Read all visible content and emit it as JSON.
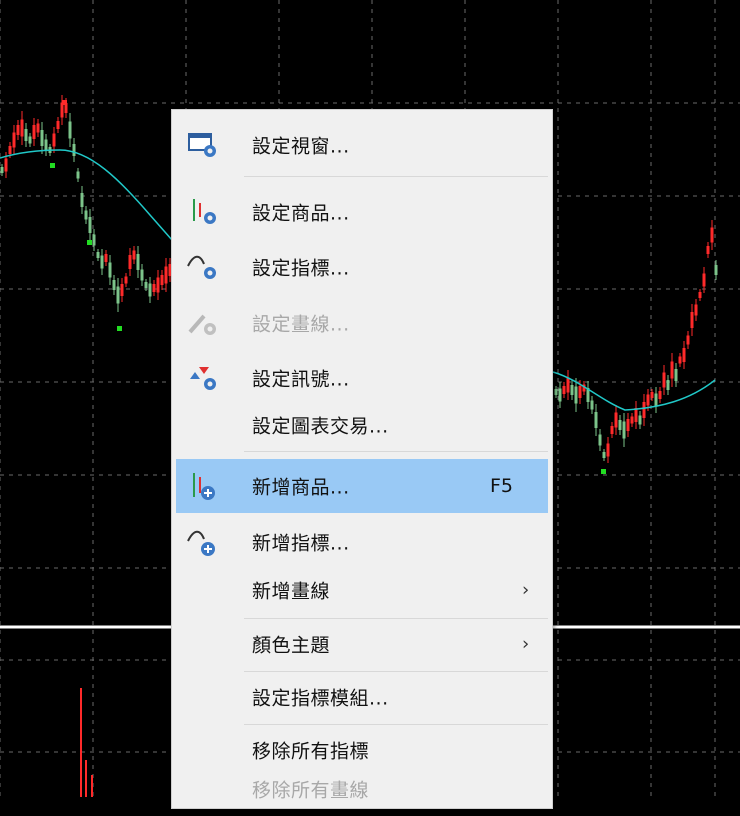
{
  "menu": {
    "items": [
      {
        "label": "設定視窗...",
        "icon": "window-settings-icon",
        "shortcut": "",
        "submenu": false,
        "disabled": false,
        "highlighted": false
      },
      {
        "label": "設定商品...",
        "icon": "symbol-settings-icon",
        "shortcut": "",
        "submenu": false,
        "disabled": false,
        "highlighted": false
      },
      {
        "label": "設定指標...",
        "icon": "indicator-settings-icon",
        "shortcut": "",
        "submenu": false,
        "disabled": false,
        "highlighted": false
      },
      {
        "label": "設定畫線...",
        "icon": "drawing-settings-icon",
        "shortcut": "",
        "submenu": false,
        "disabled": true,
        "highlighted": false
      },
      {
        "label": "設定訊號...",
        "icon": "signal-settings-icon",
        "shortcut": "",
        "submenu": false,
        "disabled": false,
        "highlighted": false
      },
      {
        "label": "設定圖表交易...",
        "icon": "",
        "shortcut": "",
        "submenu": false,
        "disabled": false,
        "highlighted": false
      },
      {
        "label": "新增商品...",
        "icon": "add-symbol-icon",
        "shortcut": "F5",
        "submenu": false,
        "disabled": false,
        "highlighted": true
      },
      {
        "label": "新增指標...",
        "icon": "add-indicator-icon",
        "shortcut": "",
        "submenu": false,
        "disabled": false,
        "highlighted": false
      },
      {
        "label": "新增畫線",
        "icon": "",
        "shortcut": "",
        "submenu": true,
        "disabled": false,
        "highlighted": false
      },
      {
        "label": "顏色主題",
        "icon": "",
        "shortcut": "",
        "submenu": true,
        "disabled": false,
        "highlighted": false
      },
      {
        "label": "設定指標模組...",
        "icon": "",
        "shortcut": "",
        "submenu": false,
        "disabled": false,
        "highlighted": false
      },
      {
        "label": "移除所有指標",
        "icon": "",
        "shortcut": "",
        "submenu": false,
        "disabled": false,
        "highlighted": false
      },
      {
        "label": "移除所有畫線",
        "icon": "",
        "shortcut": "",
        "submenu": false,
        "disabled": true,
        "highlighted": false
      }
    ],
    "submenu_arrow": "›"
  },
  "colors": {
    "chart_background": "#000000",
    "up_candle": "#ff2a2a",
    "down_candle": "#7cc48a",
    "moving_average": "#20c8c8",
    "menu_background": "#f0f0f0",
    "menu_highlight": "#99c9f5",
    "icon_blue": "#3b78c4"
  }
}
